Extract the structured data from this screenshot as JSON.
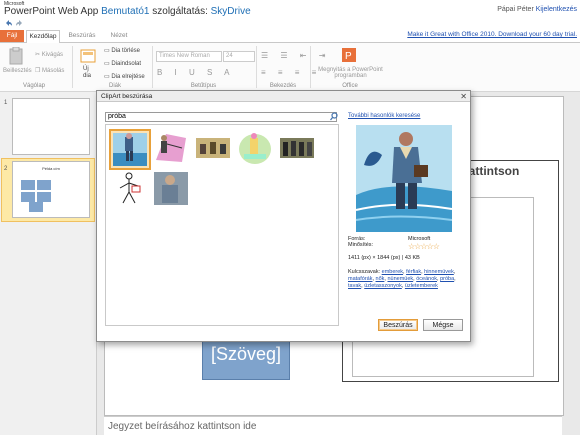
{
  "app": {
    "vendor": "Microsoft",
    "name": "PowerPoint Web App",
    "document": "Bemutató1",
    "service_prefix": "szolgáltatás:",
    "service": "SkyDrive",
    "user": "Pápai Péter",
    "signout": "Kijelentkezés"
  },
  "tabs": {
    "file": "Fájl",
    "home": "Kezdőlap",
    "insert": "Beszúrás",
    "view": "Nézet"
  },
  "promo": "Make it Great with Office 2010. Download your 60 day trial.",
  "ribbon": {
    "paste": "Beillesztés",
    "cut": "Kivágás",
    "copy": "Másolás",
    "clipboard_group": "Vágólap",
    "new_slide": "Új dia",
    "delete_slide": "Dia törlése",
    "duplicate_slide": "Diaindsolat",
    "hide_slide": "Dia elrejtése",
    "slides_group": "Diák",
    "font_name": "Times New Roman",
    "font_size": "24",
    "font_group": "Betűtípus",
    "paragraph_group": "Bekezdés",
    "open_in_ppt": "Megnyitás a PowerPoint programban",
    "office_group": "Office"
  },
  "slides": {
    "first_num": "1",
    "second_num": "2",
    "second_title": "Példa cím"
  },
  "slide": {
    "title_placeholder_tail": "kattintson",
    "content_placeholder": "[Szöveg]"
  },
  "notes": "Jegyzet beírásához kattintson ide",
  "dialog": {
    "title": "ClipArt beszúrása",
    "close": "✕",
    "search_value": "próba",
    "similar_link": "További hasonlók keresése",
    "format_label": "Forrás:",
    "format_value": "Microsoft",
    "rating_label": "Minősítés:",
    "rating": "☆☆☆☆☆",
    "size_info": "1411 (px) × 1844 (px) | 43 KB",
    "keywords_label": "Kulcsszavak:",
    "keywords": [
      "emberek",
      "férfiak",
      "hinnemüvek",
      "matafórák",
      "nők",
      "nünemüek",
      "óceánok",
      "próba",
      "tavak",
      "üzletasszonyok",
      "üzletemberek"
    ],
    "insert_button": "Beszúrás",
    "cancel_button": "Mégse"
  },
  "colors": {
    "accent": "#e8703a",
    "selection": "#e8a13a",
    "placeholder_fill": "#7fa3cc",
    "link": "#1f50b0"
  }
}
